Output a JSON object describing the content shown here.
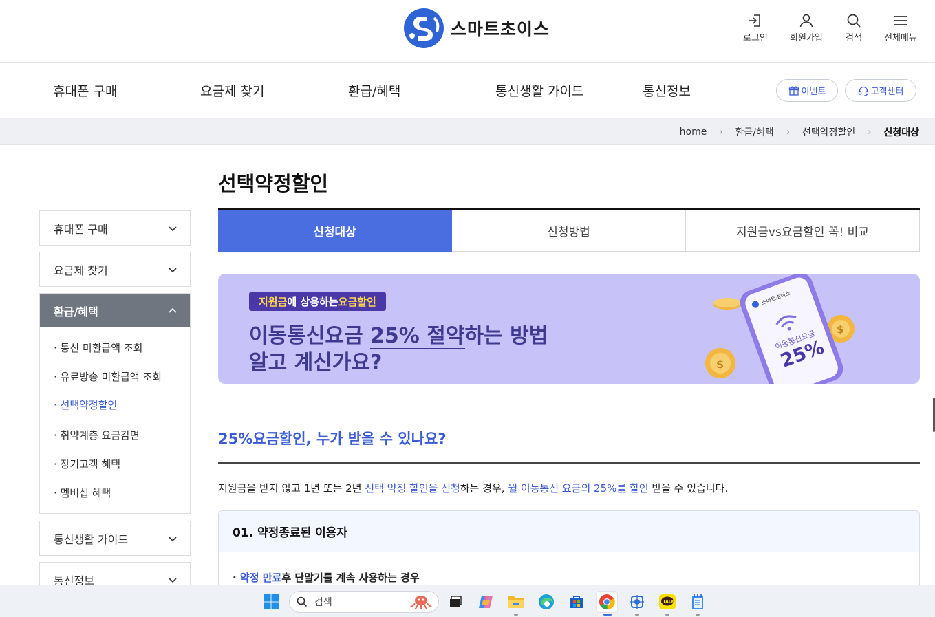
{
  "header": {
    "logo_text": "스마트초이스",
    "utils": {
      "login": "로그인",
      "signup": "회원가입",
      "search": "검색",
      "menu": "전체메뉴"
    }
  },
  "gnb": {
    "items": [
      "휴대폰 구매",
      "요금제 찾기",
      "환급/혜택",
      "통신생활 가이드",
      "통신정보"
    ],
    "event_label": "이벤트",
    "support_label": "고객센터"
  },
  "breadcrumb": [
    "home",
    "환급/혜택",
    "선택약정할인",
    "신청대상"
  ],
  "page_title": "선택약정할인",
  "tabs": [
    {
      "label": "신청대상",
      "active": true
    },
    {
      "label": "신청방법",
      "active": false
    },
    {
      "label": "지원금vs요금할인 꼭! 비교",
      "active": false
    }
  ],
  "banner": {
    "badge_part1": "지원금",
    "badge_part2": "에 상응하는 ",
    "badge_part3": "요금할인",
    "line1_a": "이동통신요금 ",
    "line1_b": "25% 절약",
    "line1_c": "하는 방법",
    "line2": "알고 계신가요?",
    "phone_brand": "스마트초이스",
    "phone_label": "이동통신요금",
    "phone_value": "25%"
  },
  "sidebar": {
    "sections": [
      {
        "label": "휴대폰 구매",
        "open": false
      },
      {
        "label": "요금제 찾기",
        "open": false
      },
      {
        "label": "환급/혜택",
        "open": true
      },
      {
        "label": "통신생활 가이드",
        "open": false
      },
      {
        "label": "통신정보",
        "open": false
      }
    ],
    "sub_items": [
      "· 통신 미환급액 조회",
      "· 유료방송 미환급액 조회",
      "· 선택약정할인",
      "· 취약계층 요금감면",
      "· 장기고객 혜택",
      "· 멤버십 혜택"
    ],
    "active_sub": "· 선택약정할인"
  },
  "section": {
    "title": "25%요금할인, 누가 받을 수 있나요?",
    "desc_a": "지원금을 받지 않고 1년 또는 2년 ",
    "desc_b": "선택 약정 할인을 신청",
    "desc_c": "하는 경우, ",
    "desc_d": "월 이동통신 요금의 25%를 할인",
    "desc_e": " 받을 수 있습니다.",
    "card_title": "01. 약정종료된 이용자",
    "card_item_prefix": "· ",
    "card_item_blue": "약정 만료",
    "card_item_rest": "후 단말기를 계속 사용하는 경우"
  },
  "taskbar": {
    "search_placeholder": "검색"
  },
  "colors": {
    "accent": "#4a6ee0",
    "banner_bg": "#c7c2f7",
    "banner_text": "#3f3a8f",
    "sidebar_open": "#6f7680"
  }
}
